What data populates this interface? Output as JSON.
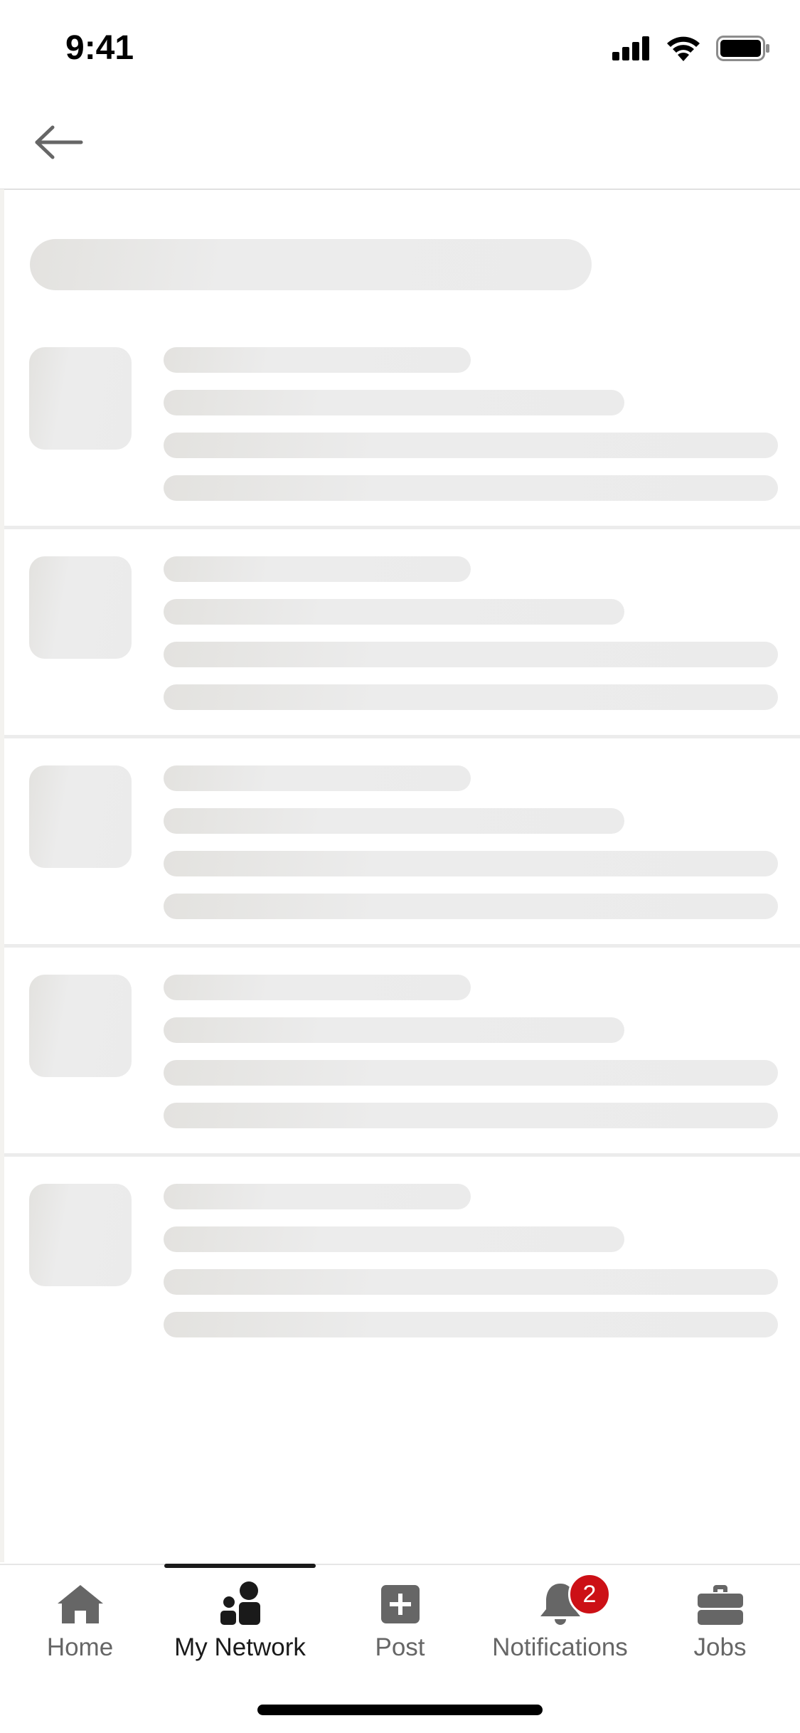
{
  "status_bar": {
    "time": "9:41",
    "icons": [
      "cellular-signal-icon",
      "wifi-icon",
      "battery-icon"
    ]
  },
  "header": {
    "back_icon": "arrow-left-icon"
  },
  "skeleton": {
    "card_count": 5
  },
  "bottom_nav": {
    "active_index": 1,
    "items": [
      {
        "label": "Home",
        "icon": "home-icon"
      },
      {
        "label": "My Network",
        "icon": "network-icon"
      },
      {
        "label": "Post",
        "icon": "post-plus-icon"
      },
      {
        "label": "Notifications",
        "icon": "bell-icon",
        "badge": "2"
      },
      {
        "label": "Jobs",
        "icon": "briefcase-icon"
      }
    ]
  },
  "colors": {
    "skeleton": "#EBEBEB",
    "badge": "#CC1016",
    "nav_inactive": "#666666",
    "nav_active": "#1A1A1A"
  }
}
